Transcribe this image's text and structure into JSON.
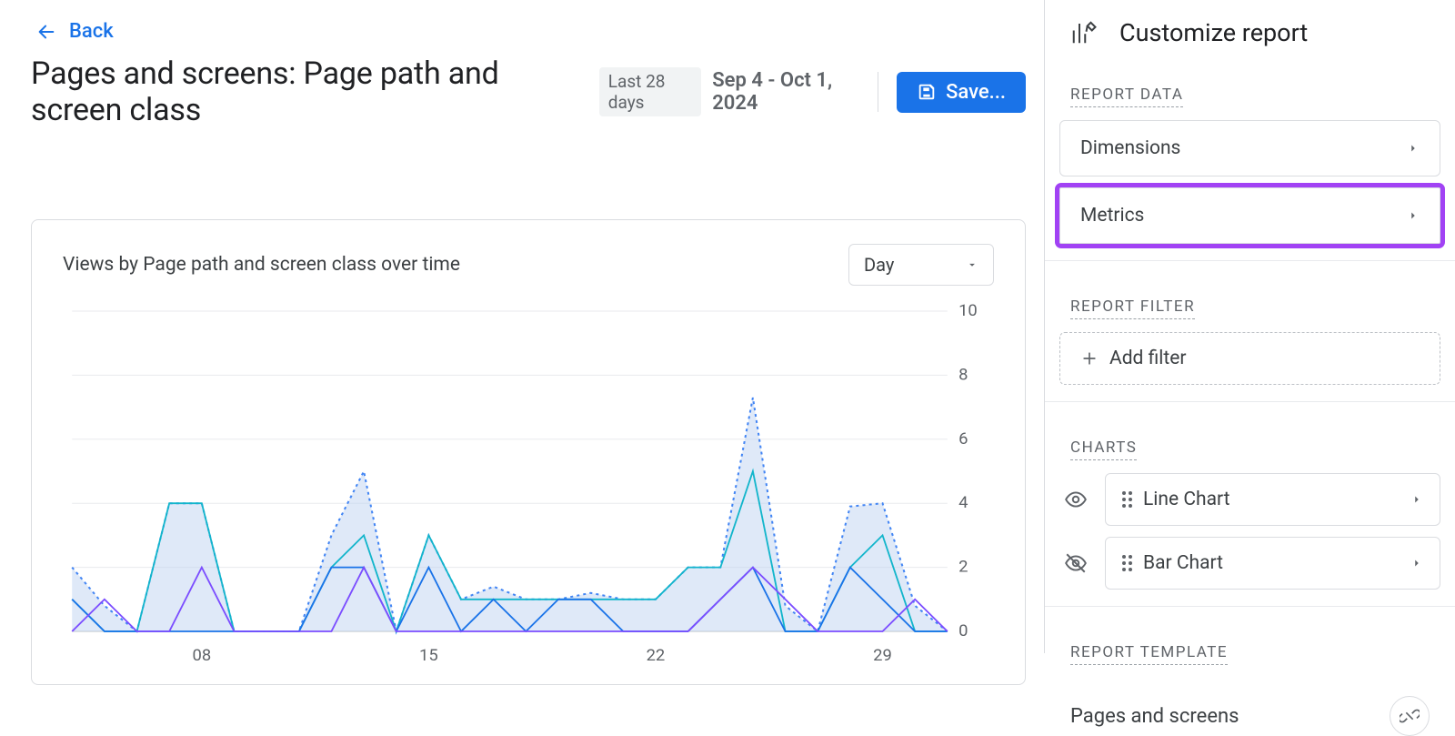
{
  "back": {
    "label": "Back"
  },
  "title": "Pages and screens: Page path and screen class",
  "range_label": "Last 28 days",
  "date_range": "Sep 4 - Oct 1, 2024",
  "save_label": "Save...",
  "chart_card": {
    "title": "Views by Page path and screen class over time",
    "granularity": "Day"
  },
  "panel": {
    "title": "Customize report",
    "report_data_label": "REPORT DATA",
    "dimensions_label": "Dimensions",
    "metrics_label": "Metrics",
    "report_filter_label": "REPORT FILTER",
    "add_filter_label": "Add filter",
    "charts_label": "CHARTS",
    "line_chart_label": "Line Chart",
    "bar_chart_label": "Bar Chart",
    "report_template_label": "REPORT TEMPLATE",
    "template_name": "Pages and screens"
  },
  "chart_data": {
    "type": "line",
    "title": "Views by Page path and screen class over time",
    "xlabel": "",
    "ylabel": "",
    "ylim": [
      0,
      10
    ],
    "y_ticks": [
      0,
      2,
      4,
      6,
      8,
      10
    ],
    "x_ticks": [
      "08",
      "15",
      "22",
      "29"
    ],
    "x_days": [
      4,
      5,
      6,
      7,
      8,
      9,
      10,
      11,
      12,
      13,
      14,
      15,
      16,
      17,
      18,
      19,
      20,
      21,
      22,
      23,
      24,
      25,
      26,
      27,
      28,
      29,
      30,
      1
    ],
    "series": [
      {
        "name": "total_dotted",
        "style": "dotted",
        "color": "#4285f4",
        "values": [
          2,
          0.8,
          0,
          4,
          4,
          0,
          0,
          0,
          3,
          5,
          0,
          3,
          1,
          1.4,
          1,
          1,
          1.2,
          1,
          1,
          2,
          2,
          7.3,
          0.8,
          0,
          3.9,
          4,
          0.8,
          0
        ]
      },
      {
        "name": "s_teal",
        "style": "solid",
        "color": "#12b5cb",
        "values": [
          1,
          0,
          0,
          4,
          4,
          0,
          0,
          0,
          2,
          3,
          0,
          3,
          1,
          1,
          1,
          1,
          1,
          1,
          1,
          2,
          2,
          5,
          0,
          0,
          2,
          3,
          0,
          0
        ]
      },
      {
        "name": "s_blue",
        "style": "solid",
        "color": "#1a73e8",
        "values": [
          1,
          0,
          0,
          0,
          0,
          0,
          0,
          0,
          2,
          2,
          0,
          2,
          0,
          1,
          0,
          1,
          1,
          0,
          0,
          0,
          1,
          2,
          0,
          0,
          2,
          1,
          0,
          0
        ]
      },
      {
        "name": "s_purple",
        "style": "solid",
        "color": "#7b4dff",
        "values": [
          0,
          1,
          0,
          0,
          2,
          0,
          0,
          0,
          0,
          2,
          0,
          0,
          0,
          0,
          0,
          0,
          0,
          0,
          0,
          0,
          1,
          2,
          1,
          0,
          0,
          0,
          1,
          0
        ]
      }
    ]
  }
}
